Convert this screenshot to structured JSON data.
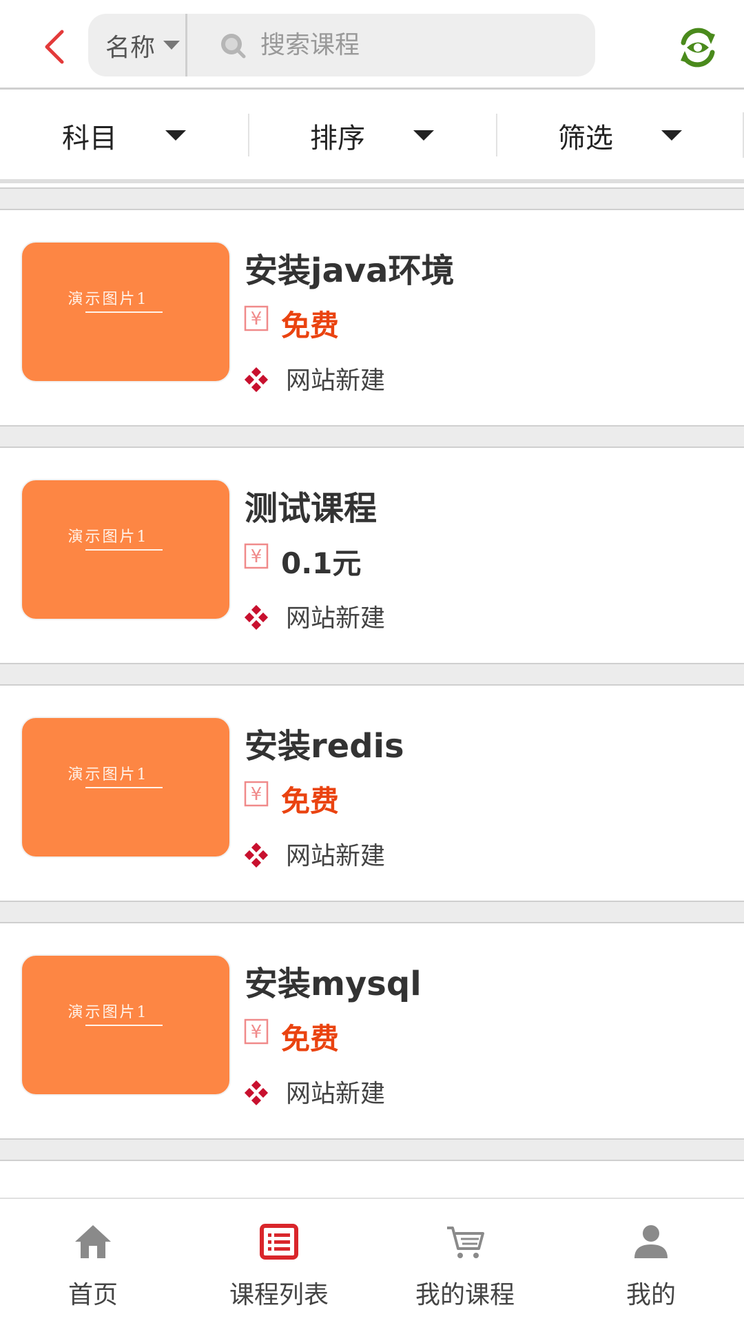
{
  "header": {
    "scope_select": "名称",
    "search_placeholder": "搜索课程",
    "back_icon": "chevron-left-icon",
    "switch_icon": "refresh-eye-icon"
  },
  "filters": [
    {
      "label": "科目"
    },
    {
      "label": "排序"
    },
    {
      "label": "筛选"
    }
  ],
  "courses": [
    {
      "thumb_caption": "演示图片1",
      "title": "安装java环境",
      "price": "免费",
      "free": true,
      "org": "网站新建"
    },
    {
      "thumb_caption": "演示图片1",
      "title": "测试课程",
      "price": "0.1元",
      "free": false,
      "org": "网站新建"
    },
    {
      "thumb_caption": "演示图片1",
      "title": "安装redis",
      "price": "免费",
      "free": true,
      "org": "网站新建"
    },
    {
      "thumb_caption": "演示图片1",
      "title": "安装mysql",
      "price": "免费",
      "free": true,
      "org": "网站新建"
    }
  ],
  "tabs": [
    {
      "label": "首页",
      "icon": "home-icon",
      "active": false
    },
    {
      "label": "课程列表",
      "icon": "list-icon",
      "active": true
    },
    {
      "label": "我的课程",
      "icon": "cart-icon",
      "active": false
    },
    {
      "label": "我的",
      "icon": "user-icon",
      "active": false
    }
  ],
  "colors": {
    "accent": "#e33a3a",
    "free_price": "#ea4310",
    "thumb_bg": "#fd8644",
    "switch_icon": "#4a8a1c",
    "org_icon": "#c8102e"
  }
}
